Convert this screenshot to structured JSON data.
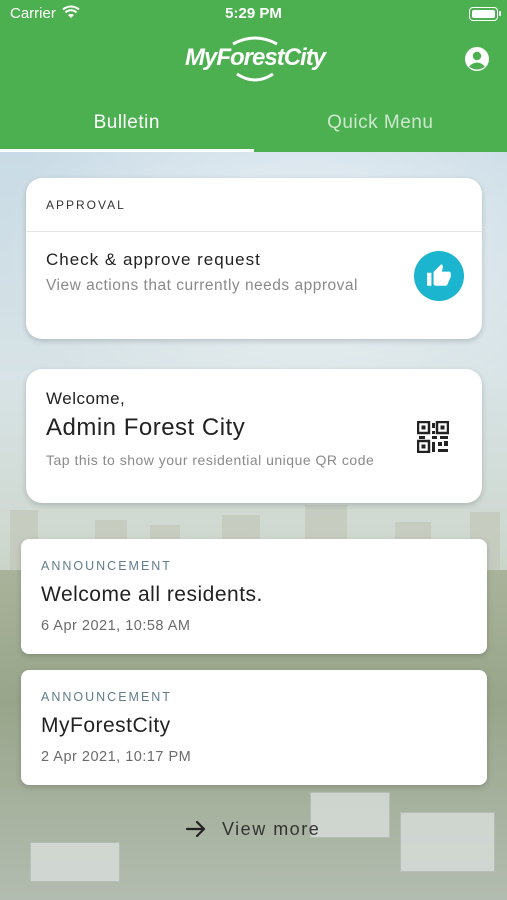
{
  "status_bar": {
    "carrier": "Carrier",
    "time": "5:29 PM"
  },
  "header": {
    "logo_text": "MyForestCity",
    "account_icon": "account-circle-icon",
    "brand_color": "#4caf50"
  },
  "tabs": [
    {
      "label": "Bulletin",
      "active": true
    },
    {
      "label": "Quick Menu",
      "active": false
    }
  ],
  "approval": {
    "section_label": "APPROVAL",
    "title": "Check & approve request",
    "description": "View actions that currently needs approval",
    "icon": "thumbs-up-icon",
    "icon_color": "#1cb5cf"
  },
  "welcome": {
    "greeting": "Welcome,",
    "name": "Admin Forest City",
    "hint": "Tap this to show your residential unique QR code",
    "icon": "qr-code-icon"
  },
  "announcements": [
    {
      "label": "ANNOUNCEMENT",
      "headline": "Welcome all residents.",
      "date": "6 Apr 2021, 10:58 AM"
    },
    {
      "label": "ANNOUNCEMENT",
      "headline": "MyForestCity",
      "date": "2 Apr 2021, 10:17 PM"
    }
  ],
  "view_more": {
    "label": "View more",
    "icon": "arrow-right-icon"
  }
}
